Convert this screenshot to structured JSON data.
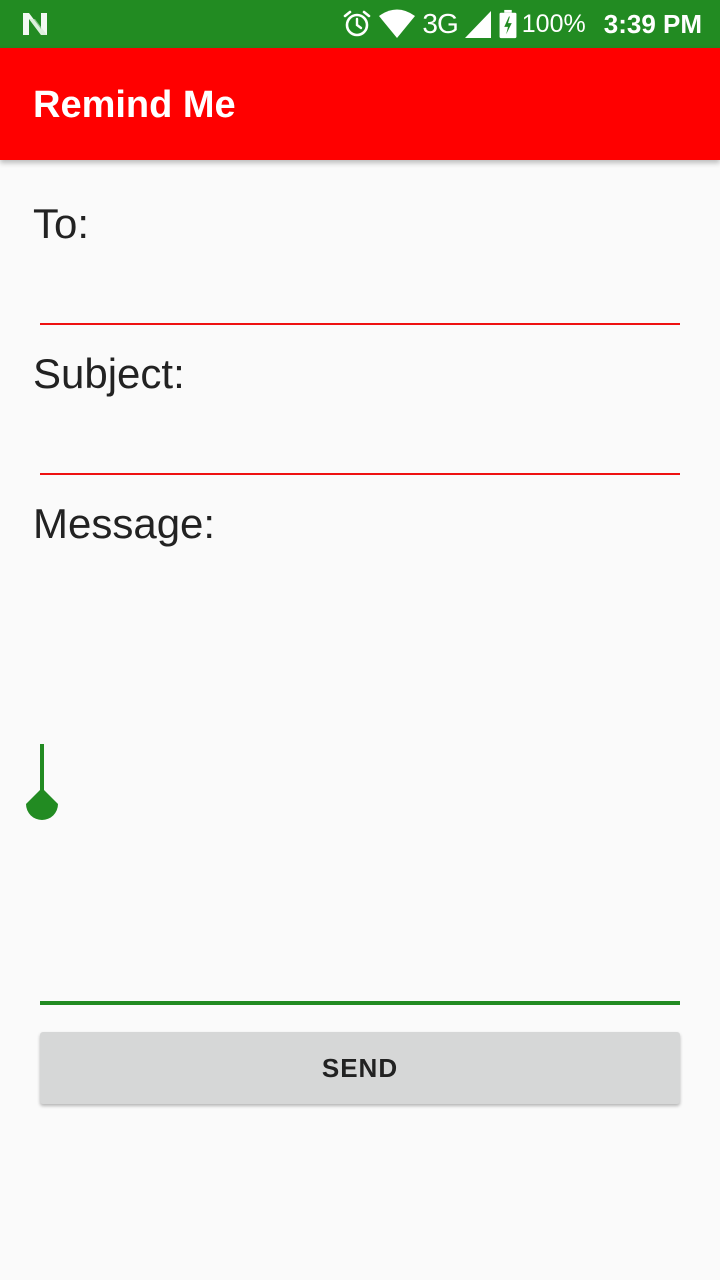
{
  "status_bar": {
    "network": "3G",
    "battery": "100%",
    "time": "3:39 PM",
    "icons": [
      "notification-n-icon",
      "alarm-icon",
      "wifi-icon",
      "cell-signal-icon",
      "battery-charging-icon"
    ]
  },
  "app_bar": {
    "title": "Remind Me"
  },
  "form": {
    "to_label": "To:",
    "subject_label": "Subject:",
    "message_label": "Message:",
    "to_value": "",
    "subject_value": "",
    "message_value": ""
  },
  "actions": {
    "send_label": "SEND"
  },
  "colors": {
    "status_bar": "#228B22",
    "app_bar": "#ff0000",
    "field_underline": "#ee1111",
    "focused_underline": "#228B22",
    "button_bg": "#d6d7d7",
    "background": "#fafafa"
  }
}
